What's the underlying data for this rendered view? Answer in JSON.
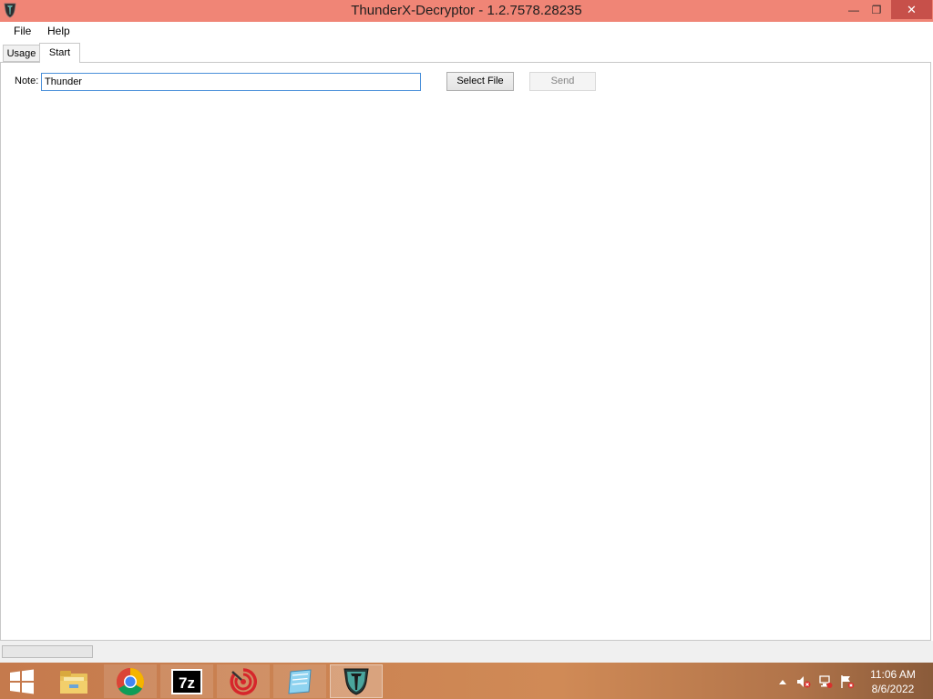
{
  "window": {
    "title": "ThunderX-Decryptor - 1.2.7578.28235",
    "minimize_glyph": "—",
    "maximize_glyph": "❐",
    "close_glyph": "✕",
    "titlebar_color": "#f08576",
    "close_color": "#c7504a"
  },
  "menu": {
    "file": "File",
    "help": "Help"
  },
  "tabs": [
    {
      "label": "Usage",
      "selected": false
    },
    {
      "label": "Start",
      "selected": true
    }
  ],
  "form": {
    "note_label": "Note:",
    "note_value": "Thunder",
    "select_file_label": "Select File",
    "send_label": "Send",
    "send_enabled": false
  },
  "taskbar": {
    "apps": [
      {
        "name": "file-explorer-icon",
        "active": false
      },
      {
        "name": "chrome-icon",
        "active": false
      },
      {
        "name": "7zip-icon",
        "label": "7z",
        "active": false
      },
      {
        "name": "red-target-app-icon",
        "active": false
      },
      {
        "name": "notepad-icon",
        "active": false
      },
      {
        "name": "thunderx-decryptor-icon",
        "active": true
      }
    ],
    "tray_icons": [
      "show-hidden-icons-icon",
      "volume-muted-icon",
      "network-icon",
      "action-center-flag-icon"
    ],
    "time": "11:06 AM",
    "date": "8/6/2022"
  }
}
